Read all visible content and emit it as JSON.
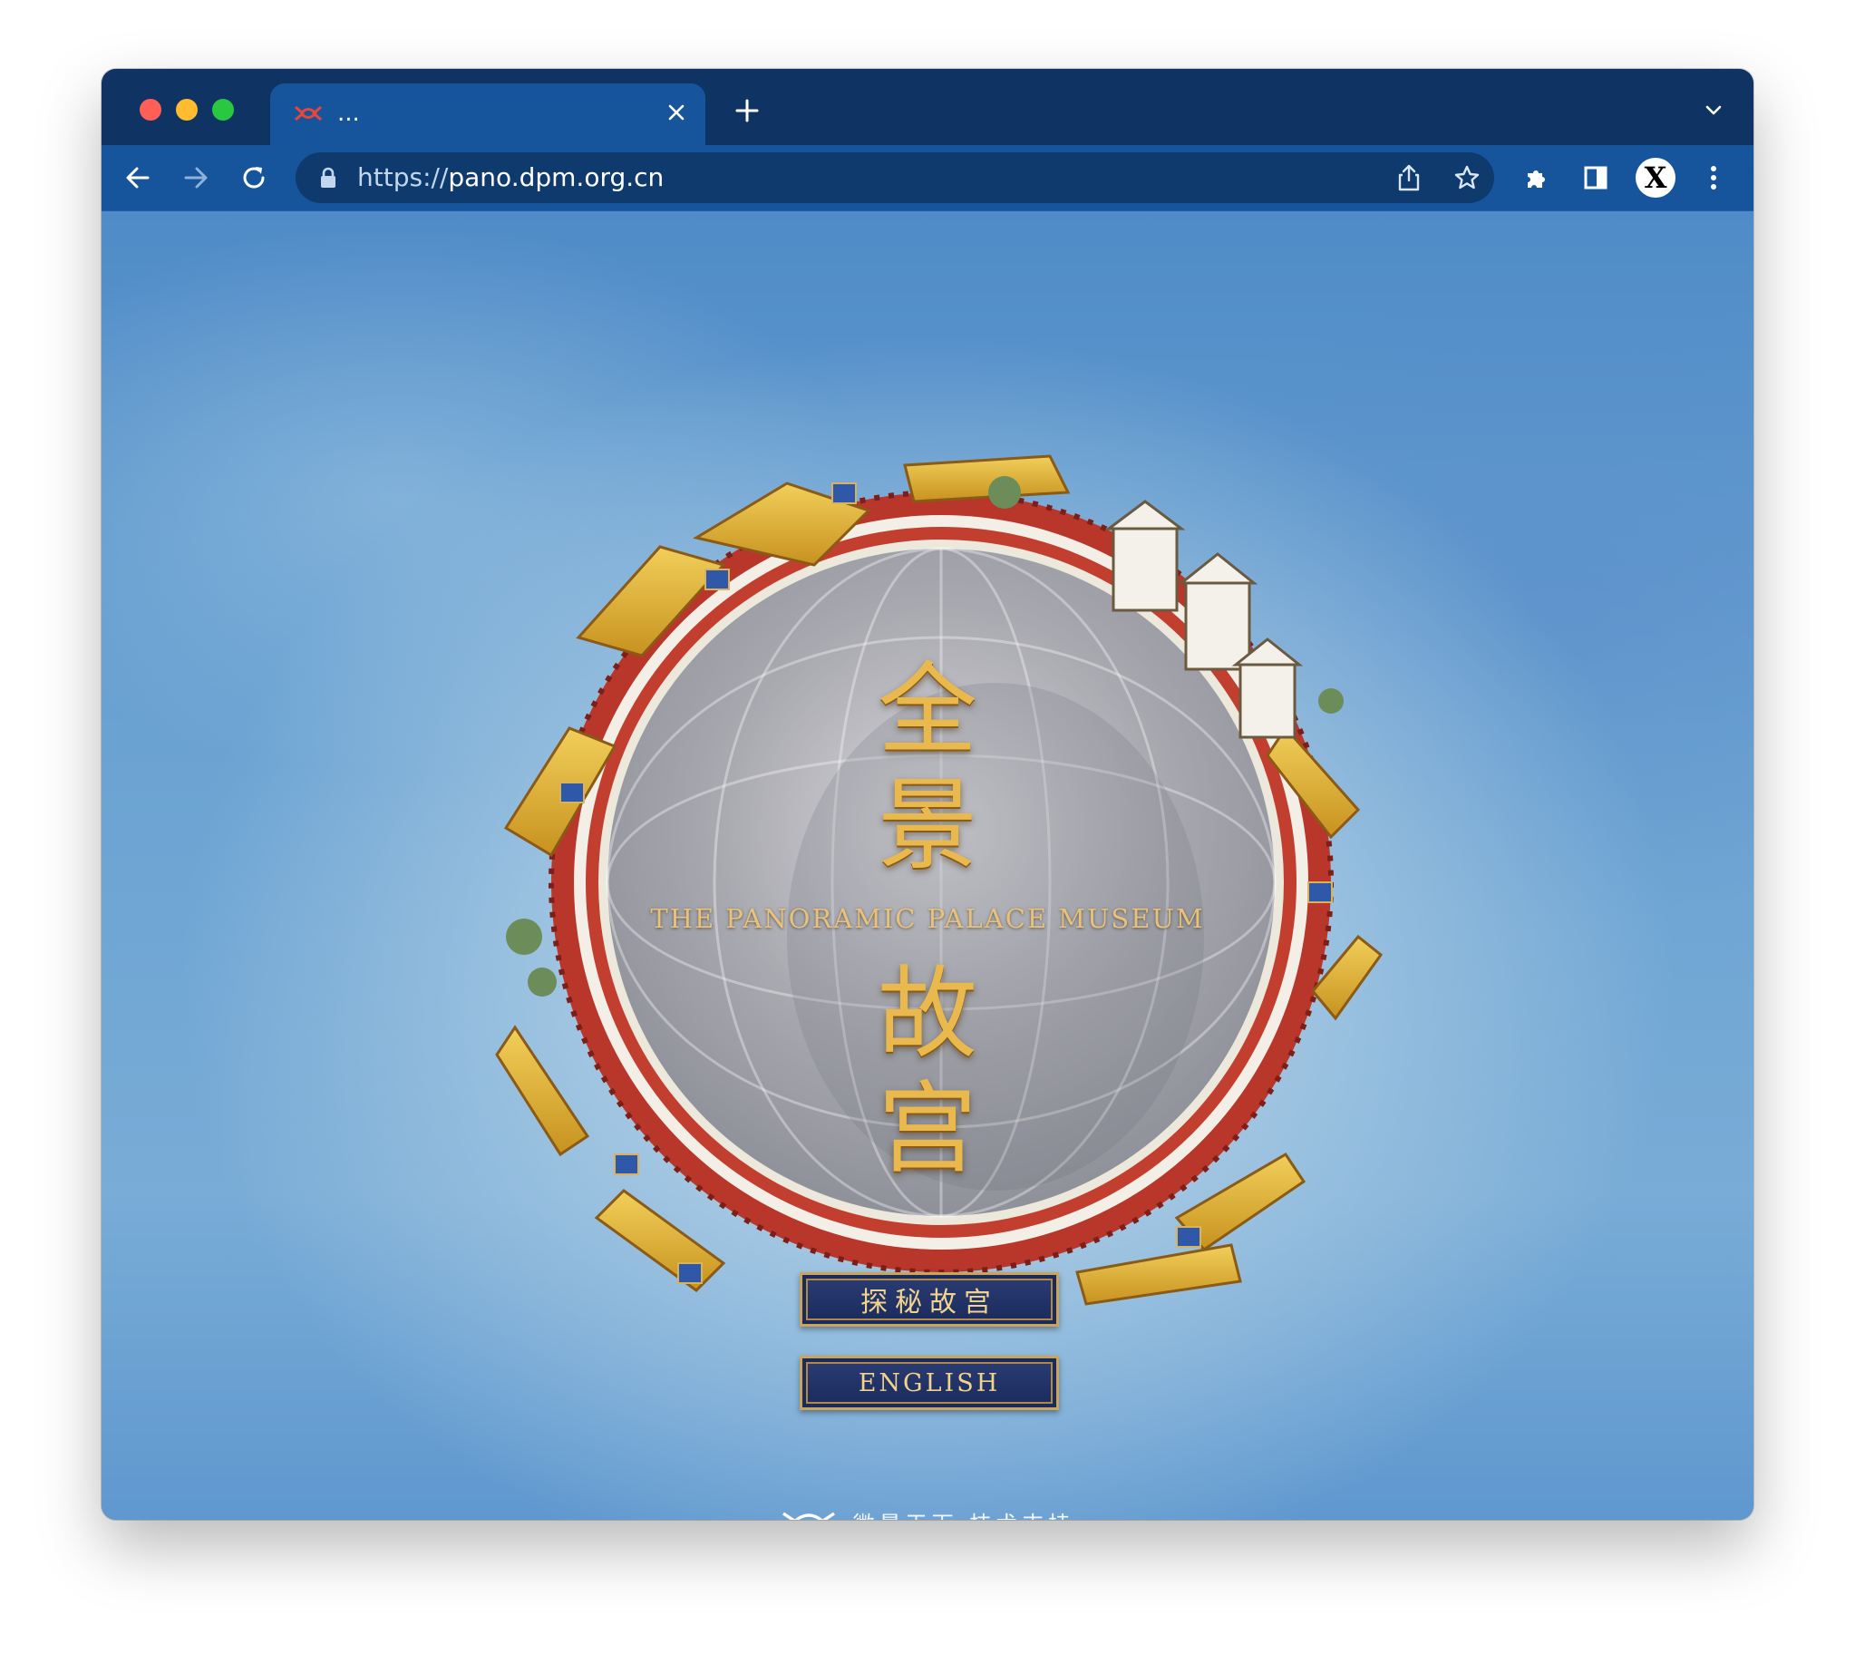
{
  "browser": {
    "tab": {
      "title": "...",
      "favicon": "vizen-logo-icon"
    },
    "toolbar": {
      "url_scheme": "https://",
      "url_host": "pano.dpm.org.cn",
      "profile_initial": "X"
    },
    "colors": {
      "tabstrip": "#0f3464",
      "toolbar": "#16549c",
      "omnibox": "#0f3a6e"
    }
  },
  "page": {
    "title_chars": [
      "全",
      "景",
      "故",
      "宫"
    ],
    "subtitle": "THE PANORAMIC PALACE MUSEUM",
    "buttons": {
      "explore": "探秘故宫",
      "english": "ENGLISH"
    },
    "footer": {
      "text": "微景天下 技术支持",
      "logo": "vizen-logo-icon"
    },
    "colors": {
      "title_gold": "#e9b94d",
      "plaque_navy": "#1a2a5c",
      "plaque_border": "#c9a45a",
      "palace_red": "#b8362a",
      "roof_yellow": "#e6b93a"
    }
  }
}
